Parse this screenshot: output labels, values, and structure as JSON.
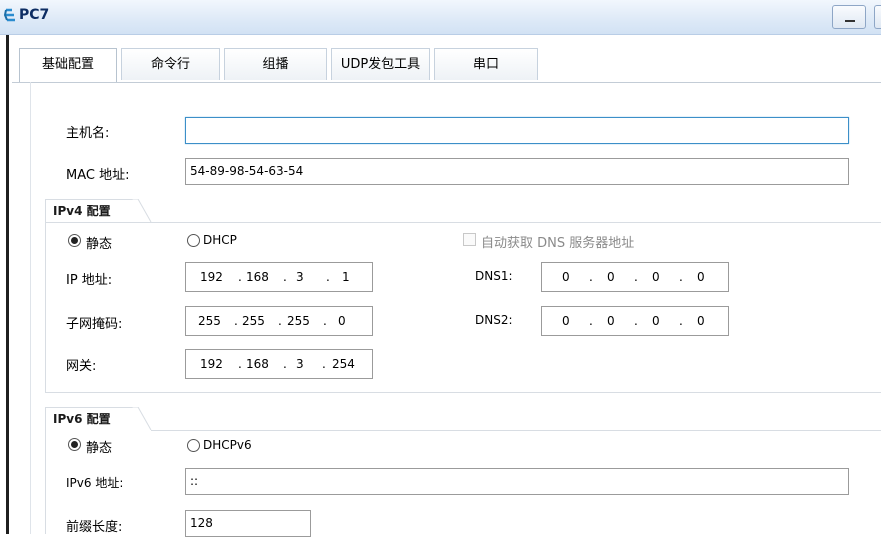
{
  "window": {
    "title": "PC7",
    "app_icon": "network-pc-icon",
    "minimize_icon": "minimize-icon"
  },
  "tabs": [
    {
      "label": "基础配置",
      "active": true
    },
    {
      "label": "命令行"
    },
    {
      "label": "组播"
    },
    {
      "label": "UDP发包工具"
    },
    {
      "label": "串口"
    }
  ],
  "basic": {
    "hostname_label": "主机名:",
    "hostname_value": "",
    "mac_label": "MAC 地址:",
    "mac_value": "54-89-98-54-63-54"
  },
  "ipv4": {
    "group_title": "IPv4 配置",
    "static_label": "静态",
    "static_selected": true,
    "dhcp_label": "DHCP",
    "auto_dns_label": "自动获取 DNS 服务器地址",
    "ip_label": "IP 地址:",
    "ip": [
      "192",
      "168",
      "3",
      "1"
    ],
    "mask_label": "子网掩码:",
    "mask": [
      "255",
      "255",
      "255",
      "0"
    ],
    "gateway_label": "网关:",
    "gateway": [
      "192",
      "168",
      "3",
      "254"
    ],
    "dns1_label": "DNS1:",
    "dns1": [
      "0",
      "0",
      "0",
      "0"
    ],
    "dns2_label": "DNS2:",
    "dns2": [
      "0",
      "0",
      "0",
      "0"
    ]
  },
  "ipv6": {
    "group_title": "IPv6 配置",
    "static_label": "静态",
    "static_selected": true,
    "dhcp_label": "DHCPv6",
    "ip_label": "IPv6 地址:",
    "ip_value": "::",
    "prefix_label": "前缀长度:",
    "prefix_value": "128"
  },
  "colors": {
    "title_text": "#0d2d63",
    "focus_border": "#3c8fc8",
    "field_border": "#9b9b9b"
  }
}
